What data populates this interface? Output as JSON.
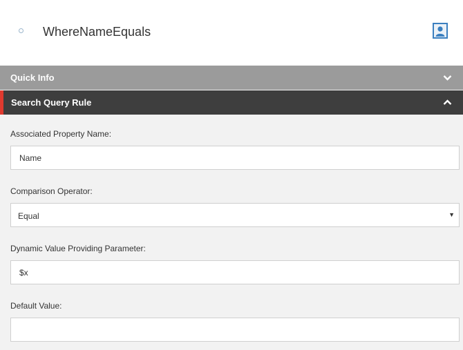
{
  "header": {
    "title": "WhereNameEquals"
  },
  "sections": {
    "quick_info": {
      "label": "Quick Info"
    },
    "search_query_rule": {
      "label": "Search Query Rule"
    }
  },
  "form": {
    "associated_property": {
      "label": "Associated Property Name:",
      "value": "Name"
    },
    "comparison_operator": {
      "label": "Comparison Operator:",
      "value": "Equal"
    },
    "dynamic_value_param": {
      "label": "Dynamic Value Providing Parameter:",
      "value": "$x"
    },
    "default_value": {
      "label": "Default Value:",
      "value": ""
    }
  },
  "colors": {
    "accent": "#e03a2f",
    "quick_info_bar": "#9b9b9b",
    "search_bar": "#3e3e3e",
    "avatar_border": "#3a7fbf"
  },
  "icons": {
    "status": "ring-icon",
    "user": "user-avatar-icon",
    "quick_info_toggle": "chevron-down-icon",
    "search_toggle": "chevron-up-icon",
    "select_caret": "caret-down-icon"
  }
}
